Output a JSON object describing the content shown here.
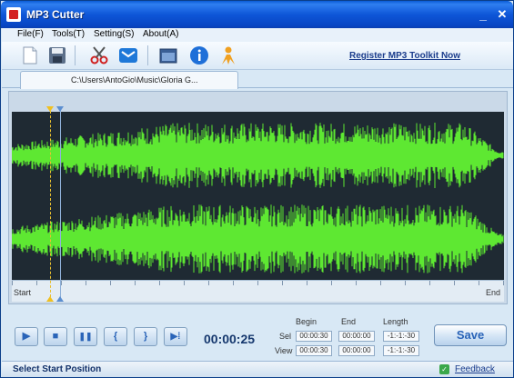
{
  "window": {
    "title": "MP3 Cutter",
    "min_glyph": "_",
    "close_glyph": "✕"
  },
  "menu": [
    {
      "label": "File(F)"
    },
    {
      "label": "Tools(T)"
    },
    {
      "label": "Setting(S)"
    },
    {
      "label": "About(A)"
    }
  ],
  "toolbar": {
    "icons": [
      "new-file-icon",
      "save-icon",
      "scissors-icon",
      "mail-icon",
      "window-icon",
      "info-icon",
      "person-icon"
    ],
    "register_label": "Register MP3 Toolkit Now"
  },
  "tab": {
    "label": "C:\\Users\\AntoGio\\Music\\Gloria G..."
  },
  "timeline": {
    "start_label": "Start",
    "end_label": "End"
  },
  "controls": {
    "play_glyph": "▶",
    "stop_glyph": "■",
    "pause_glyph": "❚❚",
    "set_begin_glyph": "{",
    "set_end_glyph": "}",
    "play_sel_glyph": "▶⁞",
    "time": "00:00:25",
    "headers": {
      "begin": "Begin",
      "end": "End",
      "length": "Length"
    },
    "sel": {
      "label": "Sel",
      "begin": "00:00:30",
      "end": "00:00:00",
      "length": "-1:-1:-30"
    },
    "view": {
      "label": "View",
      "begin": "00:00:30",
      "end": "00:00:00",
      "length": "-1:-1:-30"
    },
    "save_label": "Save"
  },
  "status": {
    "text": "Select Start Position",
    "feedback_label": "Feedback"
  },
  "colors": {
    "wave": "#5ee832",
    "wave_bg": "#1f2a33",
    "accent": "#2a64b8"
  }
}
